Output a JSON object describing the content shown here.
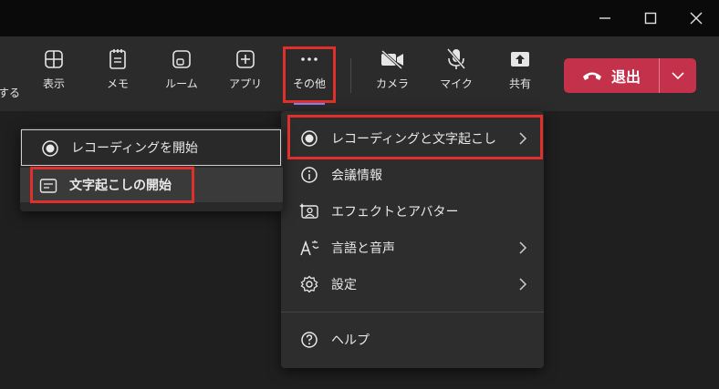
{
  "toolbar": {
    "partial_label": "する",
    "view_label": "表示",
    "notes_label": "メモ",
    "rooms_label": "ルーム",
    "apps_label": "アプリ",
    "more_label": "その他",
    "camera_label": "カメラ",
    "mic_label": "マイク",
    "share_label": "共有",
    "leave_label": "退出"
  },
  "more_menu": {
    "items": [
      {
        "label": "レコーディングと文字起こし",
        "icon": "record-icon",
        "has_submenu": true
      },
      {
        "label": "会議情報",
        "icon": "info-icon",
        "has_submenu": false
      },
      {
        "label": "エフェクトとアバター",
        "icon": "effects-icon",
        "has_submenu": false
      },
      {
        "label": "言語と音声",
        "icon": "language-icon",
        "has_submenu": true
      },
      {
        "label": "設定",
        "icon": "gear-icon",
        "has_submenu": true
      },
      {
        "label": "ヘルプ",
        "icon": "help-icon",
        "has_submenu": false
      }
    ]
  },
  "recording_submenu": {
    "items": [
      {
        "label": "レコーディングを開始",
        "icon": "record-icon"
      },
      {
        "label": "文字起こしの開始",
        "icon": "transcript-icon"
      }
    ]
  },
  "colors": {
    "highlight": "#e0302b",
    "leave_button": "#c4314b",
    "more_underline": "#7f85f5"
  }
}
